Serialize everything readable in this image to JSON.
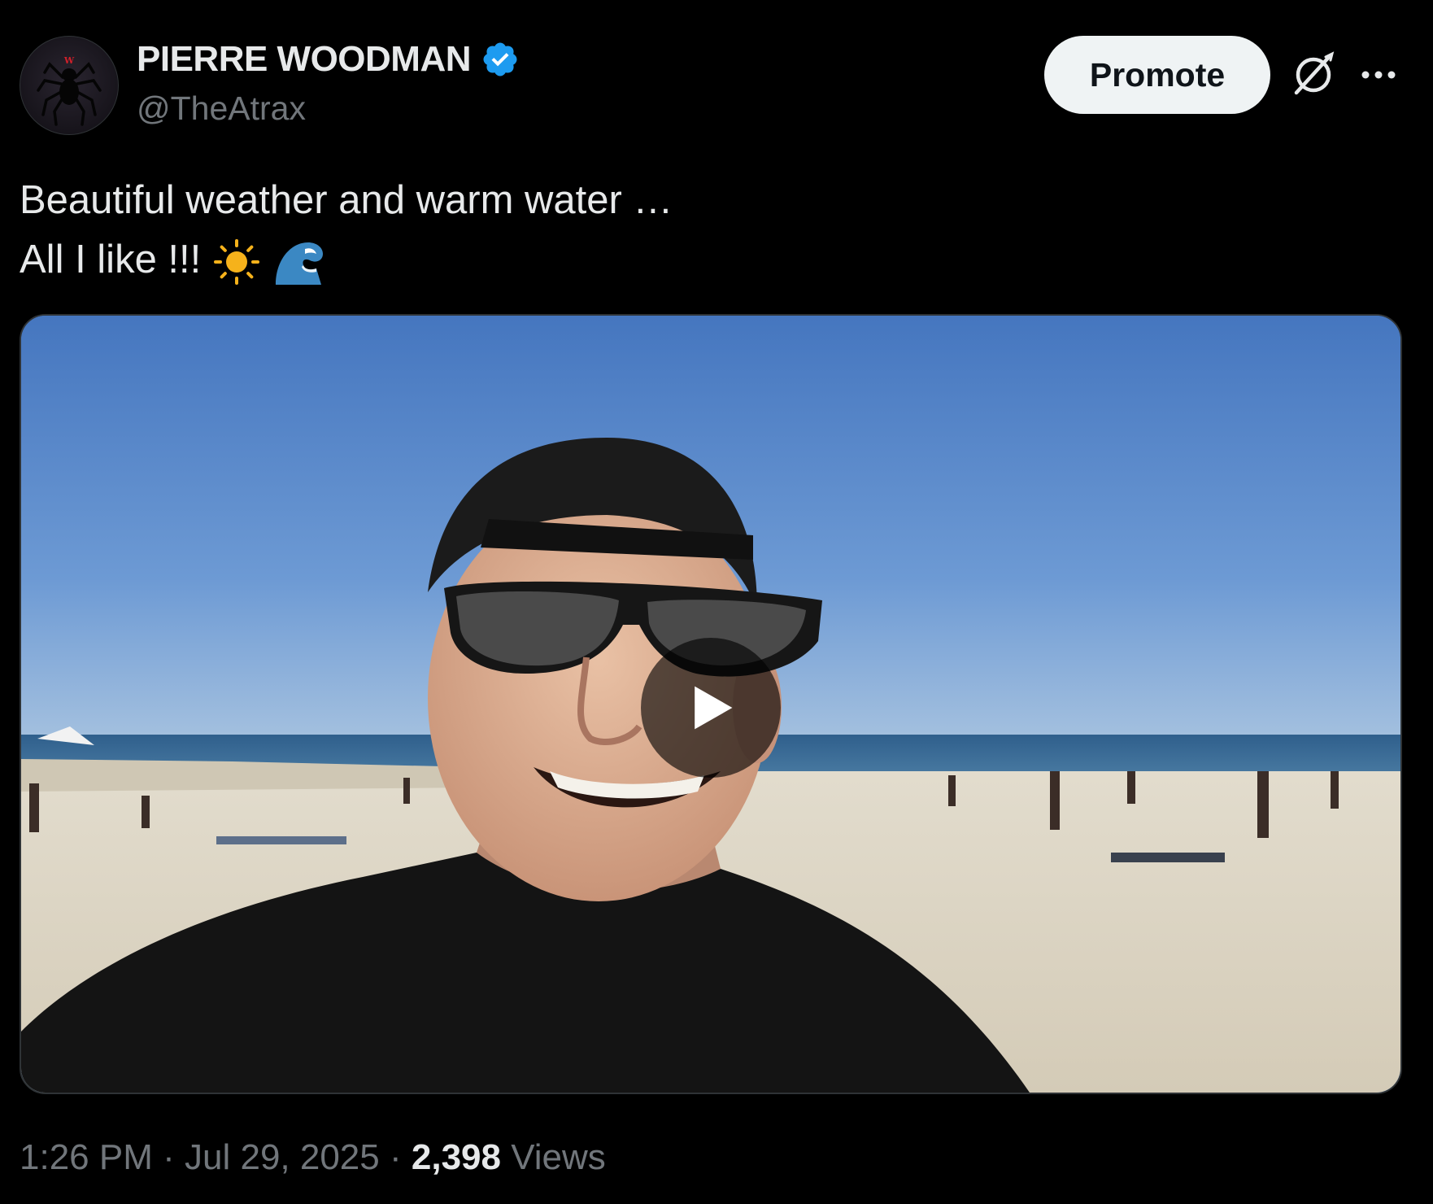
{
  "author": {
    "name": "PIERRE WOODMAN",
    "handle": "@TheAtrax",
    "verified": true,
    "avatar_icon": "spider-logo",
    "avatar_letter": "W"
  },
  "actions": {
    "promote_label": "Promote",
    "grok_icon": "grok-icon",
    "more_icon": "more-horizontal-icon"
  },
  "post": {
    "line1": "Beautiful weather and warm water …",
    "line2": "All I like !!!",
    "emojis": [
      "sun-emoji",
      "wave-emoji"
    ]
  },
  "media": {
    "type": "video",
    "play_icon": "play-icon"
  },
  "meta": {
    "time": "1:26 PM",
    "separator": "·",
    "date": "Jul 29, 2025",
    "views_count": "2,398",
    "views_label": "Views"
  },
  "colors": {
    "background": "#000000",
    "text": "#e7e9ea",
    "secondary": "#71767b",
    "verified": "#1d9bf0",
    "promote_bg": "#eff3f4"
  }
}
